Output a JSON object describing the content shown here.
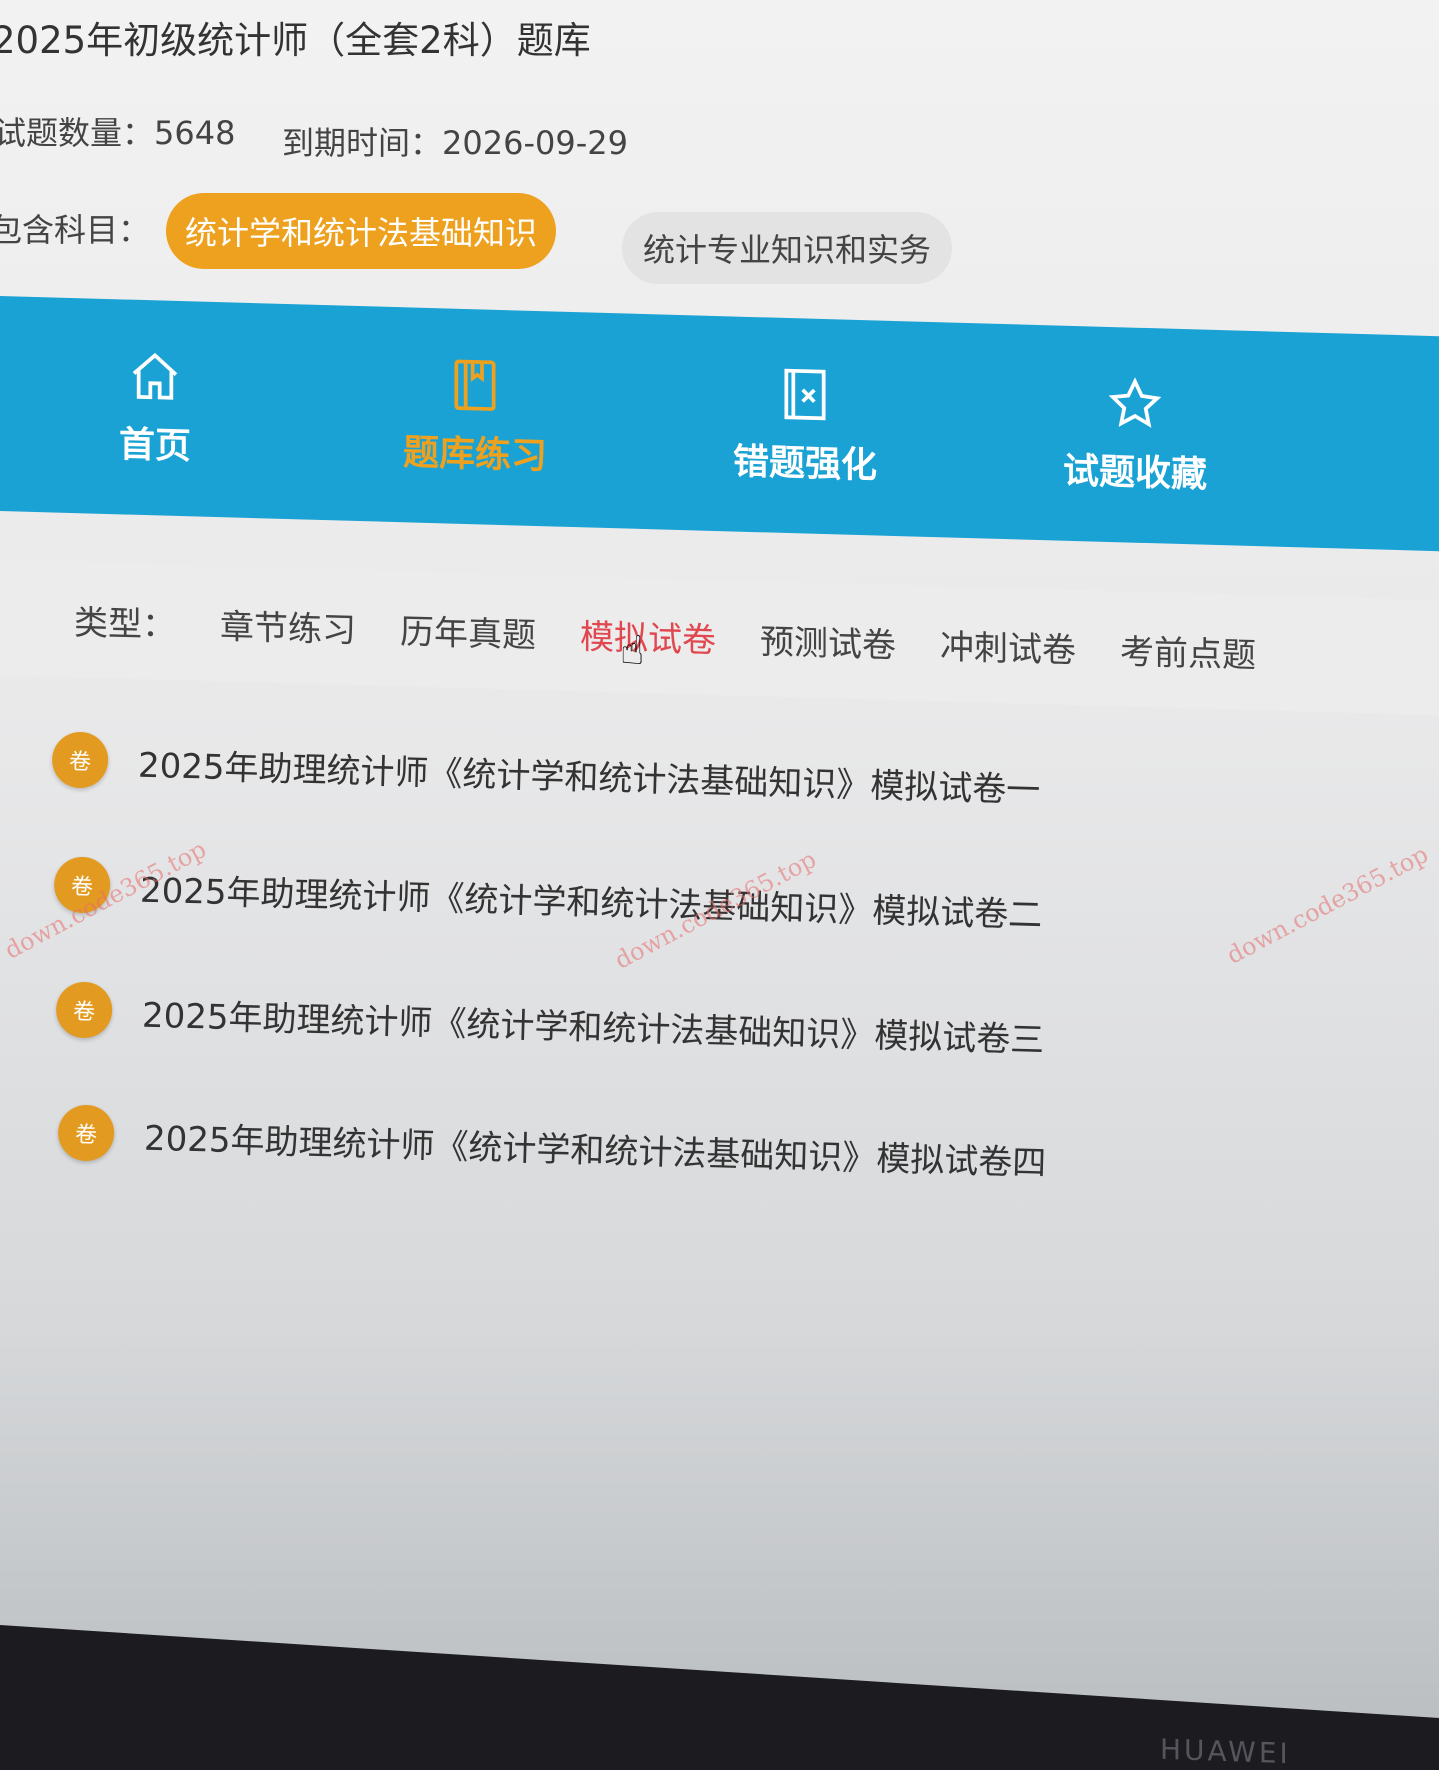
{
  "title": "2025年初级统计师（全套2科）题库",
  "info": {
    "count_label": "试题数量：",
    "count": "5648",
    "expire_label": "到期时间：",
    "expire": "2026-09-29"
  },
  "subjects": {
    "label": "包含科目：",
    "items": [
      "统计学和统计法基础知识",
      "统计专业知识和实务"
    ],
    "active": 0
  },
  "nav": [
    {
      "label": "首页",
      "icon": "home-icon"
    },
    {
      "label": "题库练习",
      "icon": "book-icon"
    },
    {
      "label": "错题强化",
      "icon": "wrong-doc-icon"
    },
    {
      "label": "试题收藏",
      "icon": "star-icon"
    }
  ],
  "types": {
    "label": "类型：",
    "items": [
      "章节练习",
      "历年真题",
      "模拟试卷",
      "预测试卷",
      "冲刺试卷",
      "考前点题"
    ],
    "active": 2
  },
  "papers": {
    "badge": "卷",
    "items": [
      "2025年助理统计师《统计学和统计法基础知识》模拟试卷一",
      "2025年助理统计师《统计学和统计法基础知识》模拟试卷二",
      "2025年助理统计师《统计学和统计法基础知识》模拟试卷三",
      "2025年助理统计师《统计学和统计法基础知识》模拟试卷四"
    ]
  },
  "watermark": "down.code365.top",
  "device_brand": "HUAWEI",
  "colors": {
    "accent": "#eda11f",
    "nav": "#1ba2d4",
    "active_type": "#e0474f"
  }
}
